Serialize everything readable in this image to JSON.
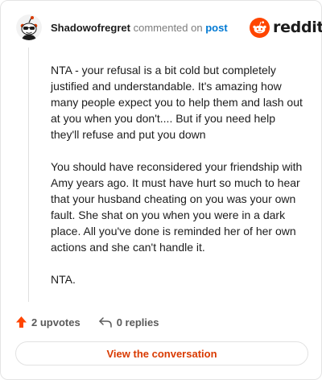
{
  "comment": {
    "username": "Shadowofregret",
    "action_text": "commented on",
    "target_link": "post",
    "paragraphs": [
      "NTA - your refusal is a bit cold but completely justified and understandable. It's amazing how many people expect you to help them and lash out at you when you don't.... But if you need help they'll refuse and put you down",
      "You should have reconsidered your friendship with Amy years ago. It must have hurt so much to hear that your husband cheating on you was your own fault. She shat on you when you were in a dark place. All you've done is reminded her of her own actions and she can't handle it.",
      "NTA."
    ]
  },
  "brand": {
    "logo_text": "reddit",
    "color": "#ff4500"
  },
  "footer": {
    "upvotes_label": "2 upvotes",
    "replies_label": "0 replies",
    "upvote_color": "#ff4500"
  },
  "cta": {
    "label": "View the conversation",
    "color": "#d93a00"
  },
  "icons": [
    "avatar-icon",
    "reddit-logo-icon",
    "upvote-arrow-icon",
    "reply-icon"
  ]
}
